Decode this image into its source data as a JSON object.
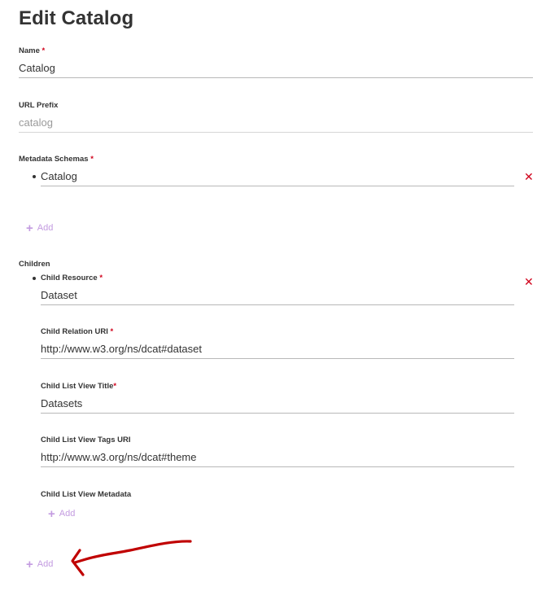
{
  "page": {
    "title": "Edit Catalog"
  },
  "fields": {
    "name": {
      "label": "Name",
      "required_mark": "*",
      "value": "Catalog"
    },
    "url_prefix": {
      "label": "URL Prefix",
      "placeholder": "catalog"
    },
    "metadata_schemas": {
      "label": "Metadata Schemas",
      "required_mark": "*",
      "items": [
        {
          "value": "Catalog"
        }
      ],
      "add_label": "Add"
    },
    "children": {
      "label": "Children",
      "items": [
        {
          "child_resource": {
            "label": "Child Resource",
            "required_mark": "*",
            "value": "Dataset"
          },
          "child_relation_uri": {
            "label": "Child Relation URI",
            "required_mark": "*",
            "value": "http://www.w3.org/ns/dcat#dataset"
          },
          "child_list_view_title": {
            "label": "Child List View Title",
            "required_mark": "*",
            "value": "Datasets"
          },
          "child_list_view_tags_uri": {
            "label": "Child List View Tags URI",
            "value": "http://www.w3.org/ns/dcat#theme"
          },
          "child_list_view_metadata": {
            "label": "Child List View Metadata",
            "add_label": "Add"
          }
        }
      ],
      "add_label": "Add"
    }
  },
  "icons": {
    "remove": "close-icon",
    "add": "plus-icon"
  },
  "colors": {
    "required": "#d0021b",
    "remove": "#d0021b",
    "add": "#c39be0",
    "annotation": "#c00000"
  }
}
